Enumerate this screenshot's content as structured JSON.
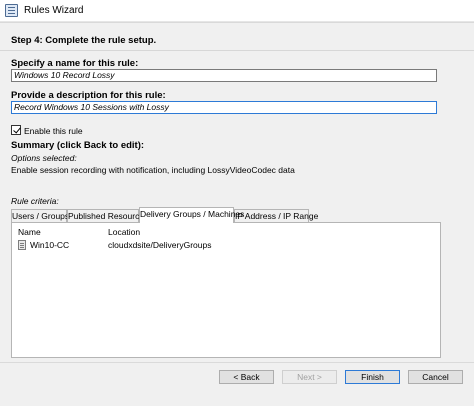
{
  "window": {
    "title": "Rules Wizard",
    "icon": "wizard-app-icon"
  },
  "step": {
    "title": "Step 4: Complete the rule setup."
  },
  "name_field": {
    "label": "Specify a name for this rule:",
    "value": "Windows 10 Record Lossy"
  },
  "description_field": {
    "label": "Provide a description for this rule:",
    "value": "Record Windows 10 Sessions with Lossy"
  },
  "enable": {
    "label": "Enable this rule",
    "checked": true
  },
  "summary": {
    "title": "Summary (click Back to edit):",
    "options_label": "Options selected:",
    "options_text": "Enable session recording with notification, including LossyVideoCodec data",
    "criteria_label": "Rule criteria:"
  },
  "tabs": [
    {
      "label": "Users / Groups",
      "active": false
    },
    {
      "label": "Published Resources",
      "active": false
    },
    {
      "label": "Delivery Groups / Machines",
      "active": true
    },
    {
      "label": "IP Address / IP Range",
      "active": false
    }
  ],
  "table": {
    "columns": [
      "Name",
      "Location"
    ],
    "rows": [
      {
        "name": "Win10-CC",
        "location": "cloudxdsite/DeliveryGroups"
      }
    ]
  },
  "buttons": {
    "back": "< Back",
    "next": "Next >",
    "finish": "Finish",
    "cancel": "Cancel"
  }
}
